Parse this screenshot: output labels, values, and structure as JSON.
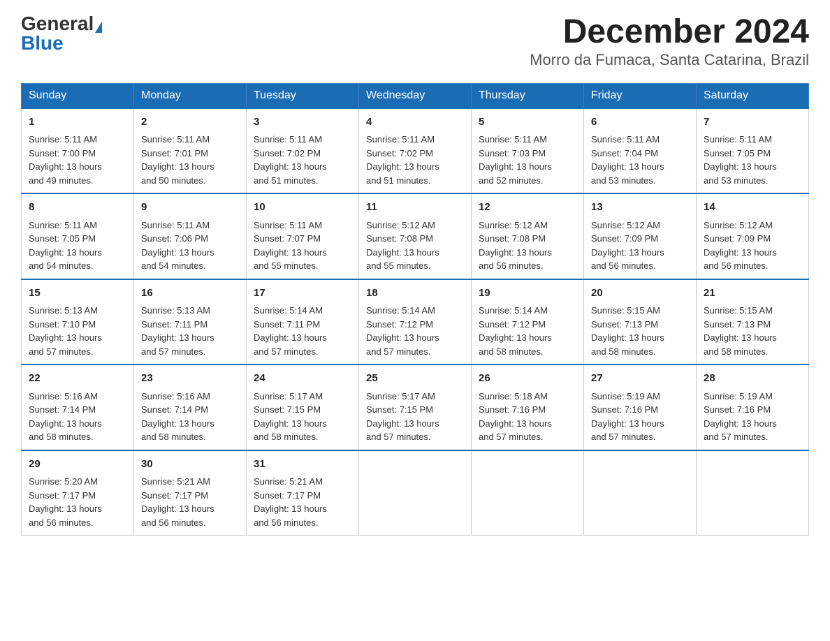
{
  "logo": {
    "general": "General",
    "blue": "Blue",
    "triangle": "▲"
  },
  "title": "December 2024",
  "subtitle": "Morro da Fumaca, Santa Catarina, Brazil",
  "days_of_week": [
    "Sunday",
    "Monday",
    "Tuesday",
    "Wednesday",
    "Thursday",
    "Friday",
    "Saturday"
  ],
  "weeks": [
    [
      {
        "day": "1",
        "sunrise": "5:11 AM",
        "sunset": "7:00 PM",
        "daylight": "13 hours and 49 minutes."
      },
      {
        "day": "2",
        "sunrise": "5:11 AM",
        "sunset": "7:01 PM",
        "daylight": "13 hours and 50 minutes."
      },
      {
        "day": "3",
        "sunrise": "5:11 AM",
        "sunset": "7:02 PM",
        "daylight": "13 hours and 51 minutes."
      },
      {
        "day": "4",
        "sunrise": "5:11 AM",
        "sunset": "7:02 PM",
        "daylight": "13 hours and 51 minutes."
      },
      {
        "day": "5",
        "sunrise": "5:11 AM",
        "sunset": "7:03 PM",
        "daylight": "13 hours and 52 minutes."
      },
      {
        "day": "6",
        "sunrise": "5:11 AM",
        "sunset": "7:04 PM",
        "daylight": "13 hours and 53 minutes."
      },
      {
        "day": "7",
        "sunrise": "5:11 AM",
        "sunset": "7:05 PM",
        "daylight": "13 hours and 53 minutes."
      }
    ],
    [
      {
        "day": "8",
        "sunrise": "5:11 AM",
        "sunset": "7:05 PM",
        "daylight": "13 hours and 54 minutes."
      },
      {
        "day": "9",
        "sunrise": "5:11 AM",
        "sunset": "7:06 PM",
        "daylight": "13 hours and 54 minutes."
      },
      {
        "day": "10",
        "sunrise": "5:11 AM",
        "sunset": "7:07 PM",
        "daylight": "13 hours and 55 minutes."
      },
      {
        "day": "11",
        "sunrise": "5:12 AM",
        "sunset": "7:08 PM",
        "daylight": "13 hours and 55 minutes."
      },
      {
        "day": "12",
        "sunrise": "5:12 AM",
        "sunset": "7:08 PM",
        "daylight": "13 hours and 56 minutes."
      },
      {
        "day": "13",
        "sunrise": "5:12 AM",
        "sunset": "7:09 PM",
        "daylight": "13 hours and 56 minutes."
      },
      {
        "day": "14",
        "sunrise": "5:12 AM",
        "sunset": "7:09 PM",
        "daylight": "13 hours and 56 minutes."
      }
    ],
    [
      {
        "day": "15",
        "sunrise": "5:13 AM",
        "sunset": "7:10 PM",
        "daylight": "13 hours and 57 minutes."
      },
      {
        "day": "16",
        "sunrise": "5:13 AM",
        "sunset": "7:11 PM",
        "daylight": "13 hours and 57 minutes."
      },
      {
        "day": "17",
        "sunrise": "5:14 AM",
        "sunset": "7:11 PM",
        "daylight": "13 hours and 57 minutes."
      },
      {
        "day": "18",
        "sunrise": "5:14 AM",
        "sunset": "7:12 PM",
        "daylight": "13 hours and 57 minutes."
      },
      {
        "day": "19",
        "sunrise": "5:14 AM",
        "sunset": "7:12 PM",
        "daylight": "13 hours and 58 minutes."
      },
      {
        "day": "20",
        "sunrise": "5:15 AM",
        "sunset": "7:13 PM",
        "daylight": "13 hours and 58 minutes."
      },
      {
        "day": "21",
        "sunrise": "5:15 AM",
        "sunset": "7:13 PM",
        "daylight": "13 hours and 58 minutes."
      }
    ],
    [
      {
        "day": "22",
        "sunrise": "5:16 AM",
        "sunset": "7:14 PM",
        "daylight": "13 hours and 58 minutes."
      },
      {
        "day": "23",
        "sunrise": "5:16 AM",
        "sunset": "7:14 PM",
        "daylight": "13 hours and 58 minutes."
      },
      {
        "day": "24",
        "sunrise": "5:17 AM",
        "sunset": "7:15 PM",
        "daylight": "13 hours and 58 minutes."
      },
      {
        "day": "25",
        "sunrise": "5:17 AM",
        "sunset": "7:15 PM",
        "daylight": "13 hours and 57 minutes."
      },
      {
        "day": "26",
        "sunrise": "5:18 AM",
        "sunset": "7:16 PM",
        "daylight": "13 hours and 57 minutes."
      },
      {
        "day": "27",
        "sunrise": "5:19 AM",
        "sunset": "7:16 PM",
        "daylight": "13 hours and 57 minutes."
      },
      {
        "day": "28",
        "sunrise": "5:19 AM",
        "sunset": "7:16 PM",
        "daylight": "13 hours and 57 minutes."
      }
    ],
    [
      {
        "day": "29",
        "sunrise": "5:20 AM",
        "sunset": "7:17 PM",
        "daylight": "13 hours and 56 minutes."
      },
      {
        "day": "30",
        "sunrise": "5:21 AM",
        "sunset": "7:17 PM",
        "daylight": "13 hours and 56 minutes."
      },
      {
        "day": "31",
        "sunrise": "5:21 AM",
        "sunset": "7:17 PM",
        "daylight": "13 hours and 56 minutes."
      },
      null,
      null,
      null,
      null
    ]
  ],
  "labels": {
    "sunrise": "Sunrise:",
    "sunset": "Sunset:",
    "daylight": "Daylight:"
  }
}
